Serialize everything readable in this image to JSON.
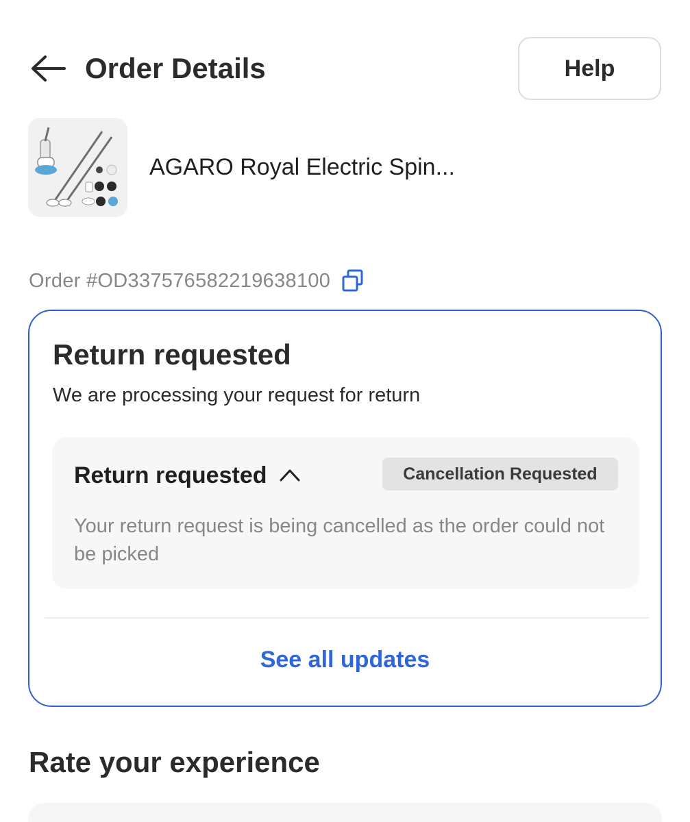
{
  "header": {
    "title": "Order Details",
    "help_label": "Help"
  },
  "product": {
    "name": "AGARO Royal Electric Spin..."
  },
  "order": {
    "id_text": "Order #OD337576582219638100"
  },
  "status_card": {
    "title": "Return requested",
    "subtitle": "We are processing your request for return",
    "panel": {
      "title": "Return requested",
      "badge": "Cancellation Requested",
      "description": "Your return request is being cancelled as the order could not be picked"
    },
    "see_all_label": "See all updates"
  },
  "rate": {
    "heading": "Rate your experience"
  },
  "icons": {
    "back": "arrow-left-icon",
    "copy": "copy-icon",
    "chevron": "chevron-up-icon"
  },
  "colors": {
    "accent": "#2f67d8",
    "card_border": "#2f5fd0",
    "muted_text": "#878787",
    "badge_bg": "#e3e3e3"
  }
}
